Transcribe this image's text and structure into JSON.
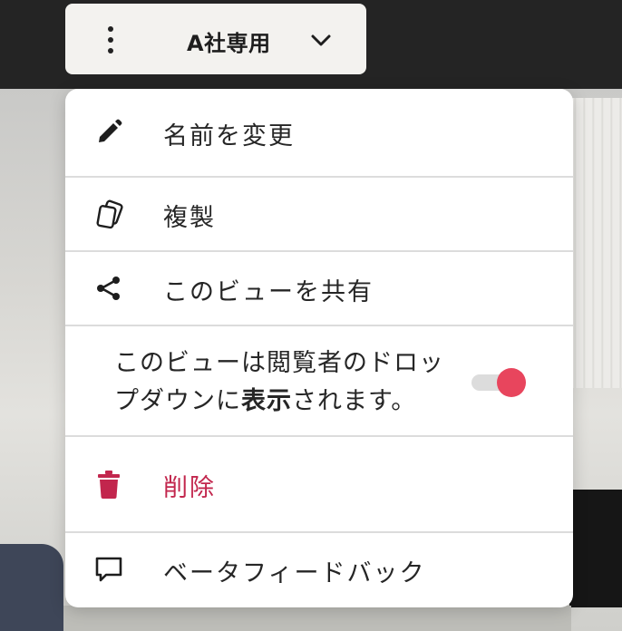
{
  "header": {
    "view_name": "A社専用"
  },
  "menu": {
    "rename": {
      "label": "名前を変更",
      "icon": "pencil-icon"
    },
    "duplicate": {
      "label": "複製",
      "icon": "copy-icon"
    },
    "share": {
      "label": "このビューを共有",
      "icon": "share-icon"
    },
    "visibility": {
      "text_before": "このビューは閲覧者のドロップダウンに",
      "text_bold": "表示",
      "text_after": "されます。",
      "enabled": true
    },
    "delete": {
      "label": "削除",
      "icon": "trash-icon"
    },
    "feedback": {
      "label": "ベータフィードバック",
      "icon": "comment-icon"
    }
  },
  "colors": {
    "accent": "#e8455d",
    "danger": "#c2264d",
    "topbar": "#242424"
  }
}
